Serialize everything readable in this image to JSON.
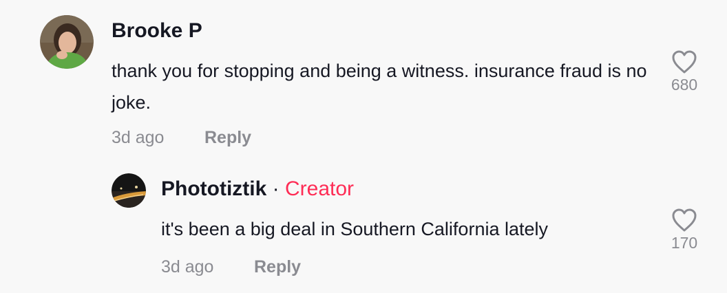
{
  "comments": [
    {
      "username": "Brooke P",
      "text": "thank you for stopping and being a witness. insurance fraud is no joke.",
      "time": "3d ago",
      "reply_label": "Reply",
      "likes": "680",
      "avatar_icon": "user-avatar-photo",
      "heart_icon": "heart-outline-icon"
    },
    {
      "username": "Phototiztik",
      "separator": "·",
      "badge": "Creator",
      "text": "it's been a big deal in Southern California lately",
      "time": "3d ago",
      "reply_label": "Reply",
      "likes": "170",
      "avatar_icon": "night-road-photo",
      "heart_icon": "heart-outline-icon"
    }
  ],
  "colors": {
    "background": "#f8f8f8",
    "text": "#161823",
    "muted": "#8a8b91",
    "creator": "#fe2c55"
  }
}
